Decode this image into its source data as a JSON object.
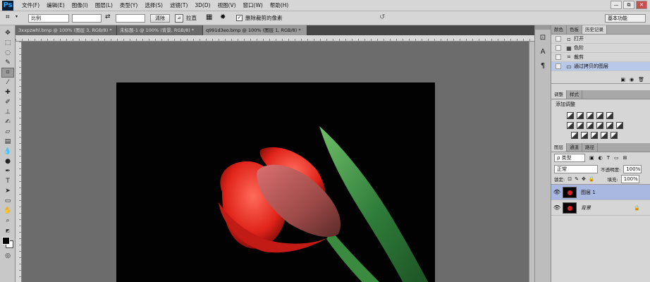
{
  "app": {
    "logo": "Ps"
  },
  "menu": [
    "文件(F)",
    "编辑(E)",
    "图像(I)",
    "图层(L)",
    "类型(Y)",
    "选择(S)",
    "滤镜(T)",
    "3D(D)",
    "视图(V)",
    "窗口(W)",
    "帮助(H)"
  ],
  "window_controls": {
    "minimize": "—",
    "restore": "⧉",
    "close": "✕"
  },
  "options": {
    "ratio_select": "比例",
    "ratio_w": "",
    "ratio_h": "",
    "clear_button": "清除",
    "straighten_label": "拉直",
    "delete_cropped_label": "删除裁剪的像素",
    "delete_cropped_checked": true,
    "workspace_select": "基本功能"
  },
  "doc_tabs": [
    {
      "label": "3xxpzwhl.bmp @ 100% (图层 3, RGB/8) *",
      "active": false
    },
    {
      "label": "未标题-1 @ 100% (背景, RGB/8) *",
      "active": false
    },
    {
      "label": "q991d3eo.bmp @ 100% (图层 1, RGB/8) *",
      "active": true
    }
  ],
  "panels": {
    "top_tabs": [
      "颜色",
      "色板",
      "历史记录"
    ],
    "history": [
      {
        "label": "打开",
        "icon": "doc-icon"
      },
      {
        "label": "色阶",
        "icon": "levels-icon"
      },
      {
        "label": "裁剪",
        "icon": "crop-icon"
      },
      {
        "label": "通过拷贝的图层",
        "icon": "layer-icon",
        "selected": true
      }
    ],
    "adj_tabs": [
      "调整",
      "样式"
    ],
    "adj_title": "添加调整",
    "layers_tabs": [
      "图层",
      "通道",
      "路径"
    ],
    "filter_select": "ρ 类型",
    "blend_mode": "正常",
    "opacity_label": "不透明度:",
    "opacity_value": "100%",
    "lock_label": "锁定:",
    "fill_label": "填充:",
    "fill_value": "100%",
    "layers": [
      {
        "name": "图层 1",
        "active": true,
        "locked": false
      },
      {
        "name": "背景",
        "active": false,
        "locked": true
      }
    ]
  },
  "colors": {
    "accent_logo": "#31a8ff",
    "canvas": "#6c6c6c",
    "selection": "#b8c8e8"
  }
}
